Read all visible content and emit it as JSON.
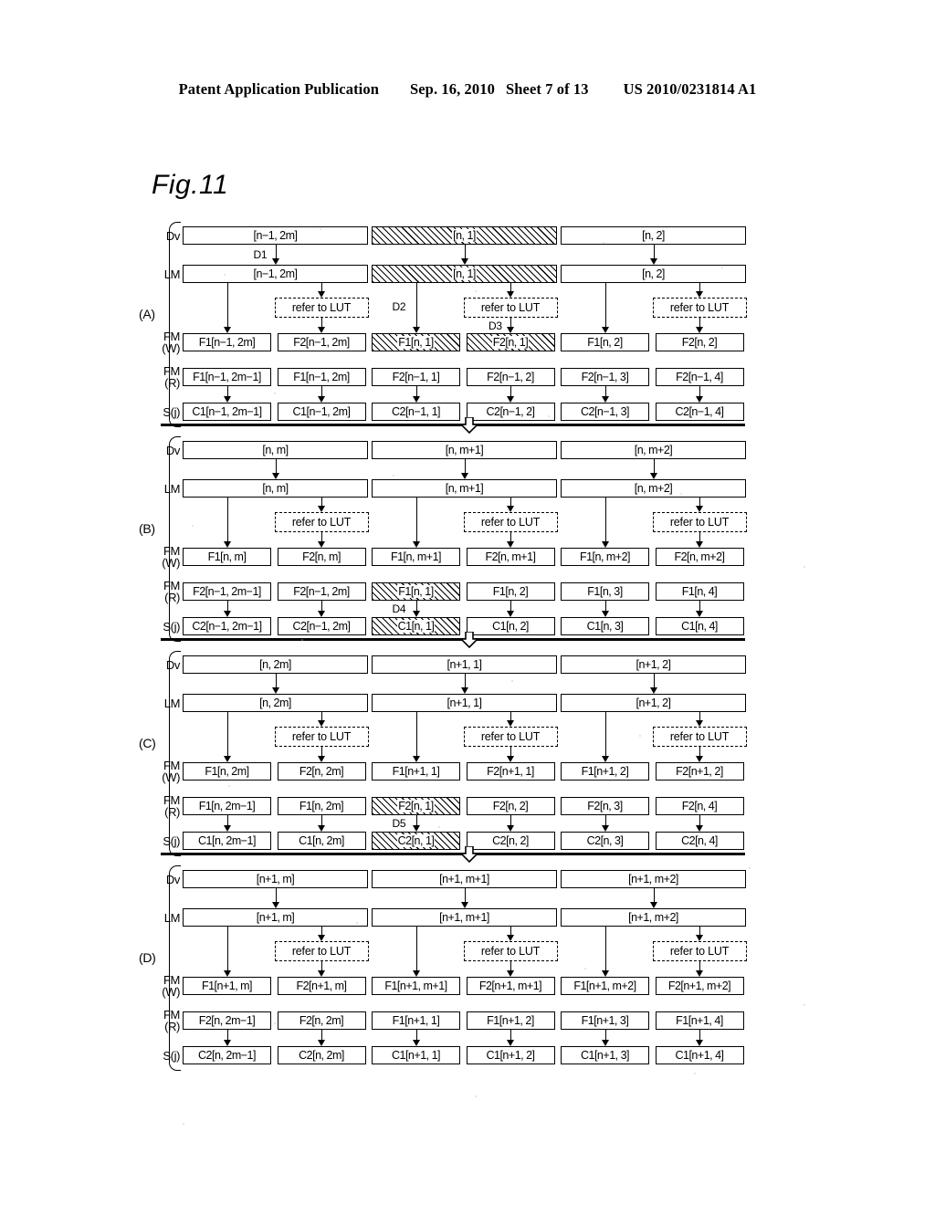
{
  "header": {
    "publication": "Patent Application Publication",
    "date": "Sep. 16, 2010",
    "sheet": "Sheet 7 of 13",
    "docnum": "US 2010/0231814 A1"
  },
  "figure": {
    "title": "Fig.11",
    "row_labels": {
      "dv": "Dv",
      "lm": "LM",
      "fmw_1": "FM",
      "fmw_2": "(W)",
      "fmr_1": "FM",
      "fmr_2": "(R)",
      "sj": "S(j)"
    },
    "lut_label": "refer to LUT",
    "sections": [
      {
        "letter": "(A)",
        "dv": [
          "[n−1, 2m]",
          "[n, 1]",
          "[n, 2]"
        ],
        "dv_hatch": [
          false,
          true,
          false
        ],
        "lm": [
          "[n−1, 2m]",
          "[n, 1]",
          "[n, 2]"
        ],
        "lm_hatch": [
          false,
          true,
          false
        ],
        "fmw": [
          "F1[n−1, 2m]",
          "F2[n−1, 2m]",
          "F1[n, 1]",
          "F2[n, 1]",
          "F1[n, 2]",
          "F2[n, 2]"
        ],
        "fmw_hatch": [
          false,
          false,
          true,
          true,
          false,
          false
        ],
        "fmr": [
          "F1[n−1, 2m−1]",
          "F1[n−1, 2m]",
          "F2[n−1, 1]",
          "F2[n−1, 2]",
          "F2[n−1, 3]",
          "F2[n−1, 4]"
        ],
        "fmr_hatch": [
          false,
          false,
          false,
          false,
          false,
          false
        ],
        "sj": [
          "C1[n−1, 2m−1]",
          "C1[n−1, 2m]",
          "C2[n−1, 1]",
          "C2[n−1, 2]",
          "C2[n−1, 3]",
          "C2[n−1, 4]"
        ],
        "sj_hatch": [
          false,
          false,
          false,
          false,
          false,
          false
        ],
        "d_labels": [
          {
            "text": "D1",
            "col": 2,
            "place": "dv-lm"
          },
          {
            "text": "D2",
            "col": 3,
            "place": "lm-fmw"
          },
          {
            "text": "D3",
            "col": 4,
            "place": "lut-fmw"
          }
        ]
      },
      {
        "letter": "(B)",
        "dv": [
          "[n, m]",
          "[n, m+1]",
          "[n, m+2]"
        ],
        "dv_hatch": [
          false,
          false,
          false
        ],
        "lm": [
          "[n, m]",
          "[n, m+1]",
          "[n, m+2]"
        ],
        "lm_hatch": [
          false,
          false,
          false
        ],
        "fmw": [
          "F1[n, m]",
          "F2[n, m]",
          "F1[n, m+1]",
          "F2[n, m+1]",
          "F1[n, m+2]",
          "F2[n, m+2]"
        ],
        "fmw_hatch": [
          false,
          false,
          false,
          false,
          false,
          false
        ],
        "fmr": [
          "F2[n−1, 2m−1]",
          "F2[n−1, 2m]",
          "F1[n, 1]",
          "F1[n, 2]",
          "F1[n, 3]",
          "F1[n, 4]"
        ],
        "fmr_hatch": [
          false,
          false,
          true,
          false,
          false,
          false
        ],
        "sj": [
          "C2[n−1, 2m−1]",
          "C2[n−1, 2m]",
          "C1[n, 1]",
          "C1[n, 2]",
          "C1[n, 3]",
          "C1[n, 4]"
        ],
        "sj_hatch": [
          false,
          false,
          true,
          false,
          false,
          false
        ],
        "d_labels": [
          {
            "text": "D4",
            "col": 3,
            "place": "fmr-sj"
          }
        ]
      },
      {
        "letter": "(C)",
        "dv": [
          "[n, 2m]",
          "[n+1, 1]",
          "[n+1, 2]"
        ],
        "dv_hatch": [
          false,
          false,
          false
        ],
        "lm": [
          "[n, 2m]",
          "[n+1, 1]",
          "[n+1, 2]"
        ],
        "lm_hatch": [
          false,
          false,
          false
        ],
        "fmw": [
          "F1[n, 2m]",
          "F2[n, 2m]",
          "F1[n+1, 1]",
          "F2[n+1, 1]",
          "F1[n+1, 2]",
          "F2[n+1, 2]"
        ],
        "fmw_hatch": [
          false,
          false,
          false,
          false,
          false,
          false
        ],
        "fmr": [
          "F1[n, 2m−1]",
          "F1[n, 2m]",
          "F2[n, 1]",
          "F2[n, 2]",
          "F2[n, 3]",
          "F2[n, 4]"
        ],
        "fmr_hatch": [
          false,
          false,
          true,
          false,
          false,
          false
        ],
        "sj": [
          "C1[n, 2m−1]",
          "C1[n, 2m]",
          "C2[n, 1]",
          "C2[n, 2]",
          "C2[n, 3]",
          "C2[n, 4]"
        ],
        "sj_hatch": [
          false,
          false,
          true,
          false,
          false,
          false
        ],
        "d_labels": [
          {
            "text": "D5",
            "col": 3,
            "place": "fmr-sj"
          }
        ]
      },
      {
        "letter": "(D)",
        "dv": [
          "[n+1, m]",
          "[n+1, m+1]",
          "[n+1, m+2]"
        ],
        "dv_hatch": [
          false,
          false,
          false
        ],
        "lm": [
          "[n+1, m]",
          "[n+1, m+1]",
          "[n+1, m+2]"
        ],
        "lm_hatch": [
          false,
          false,
          false
        ],
        "fmw": [
          "F1[n+1, m]",
          "F2[n+1, m]",
          "F1[n+1, m+1]",
          "F2[n+1, m+1]",
          "F1[n+1, m+2]",
          "F2[n+1, m+2]"
        ],
        "fmw_hatch": [
          false,
          false,
          false,
          false,
          false,
          false
        ],
        "fmr": [
          "F2[n, 2m−1]",
          "F2[n, 2m]",
          "F1[n+1, 1]",
          "F1[n+1, 2]",
          "F1[n+1, 3]",
          "F1[n+1, 4]"
        ],
        "fmr_hatch": [
          false,
          false,
          false,
          false,
          false,
          false
        ],
        "sj": [
          "C2[n, 2m−1]",
          "C2[n, 2m]",
          "C1[n+1, 1]",
          "C1[n+1, 2]",
          "C1[n+1, 3]",
          "C1[n+1, 4]"
        ],
        "sj_hatch": [
          false,
          false,
          false,
          false,
          false,
          false
        ],
        "d_labels": []
      }
    ]
  }
}
